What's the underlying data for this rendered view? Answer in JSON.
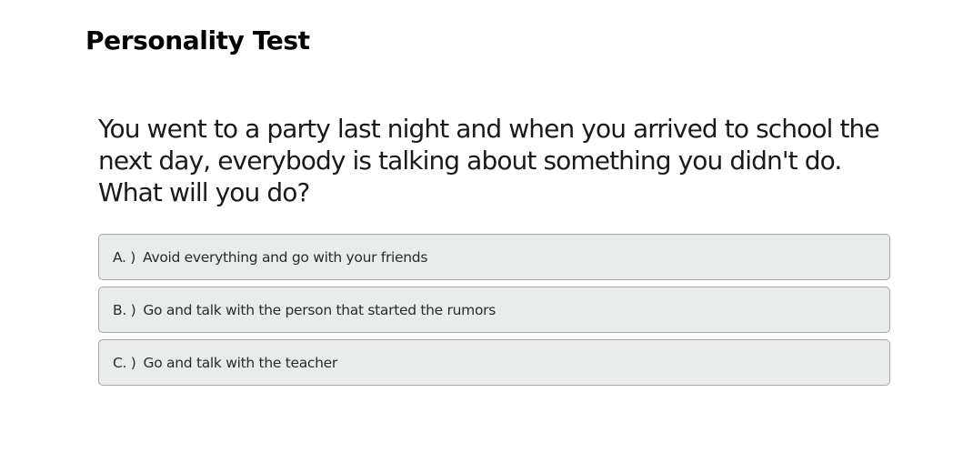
{
  "app": {
    "title": "Personality Test"
  },
  "question": {
    "text": "You went to a party last night and when you arrived to school the next day, everybody is talking about something you didn't do. What will you do?"
  },
  "options": [
    {
      "letter": "A. )",
      "text": "Avoid everything and go with your friends"
    },
    {
      "letter": "B. )",
      "text": "Go and talk with the person that started the rumors"
    },
    {
      "letter": "C. )",
      "text": "Go and talk with the teacher"
    }
  ]
}
